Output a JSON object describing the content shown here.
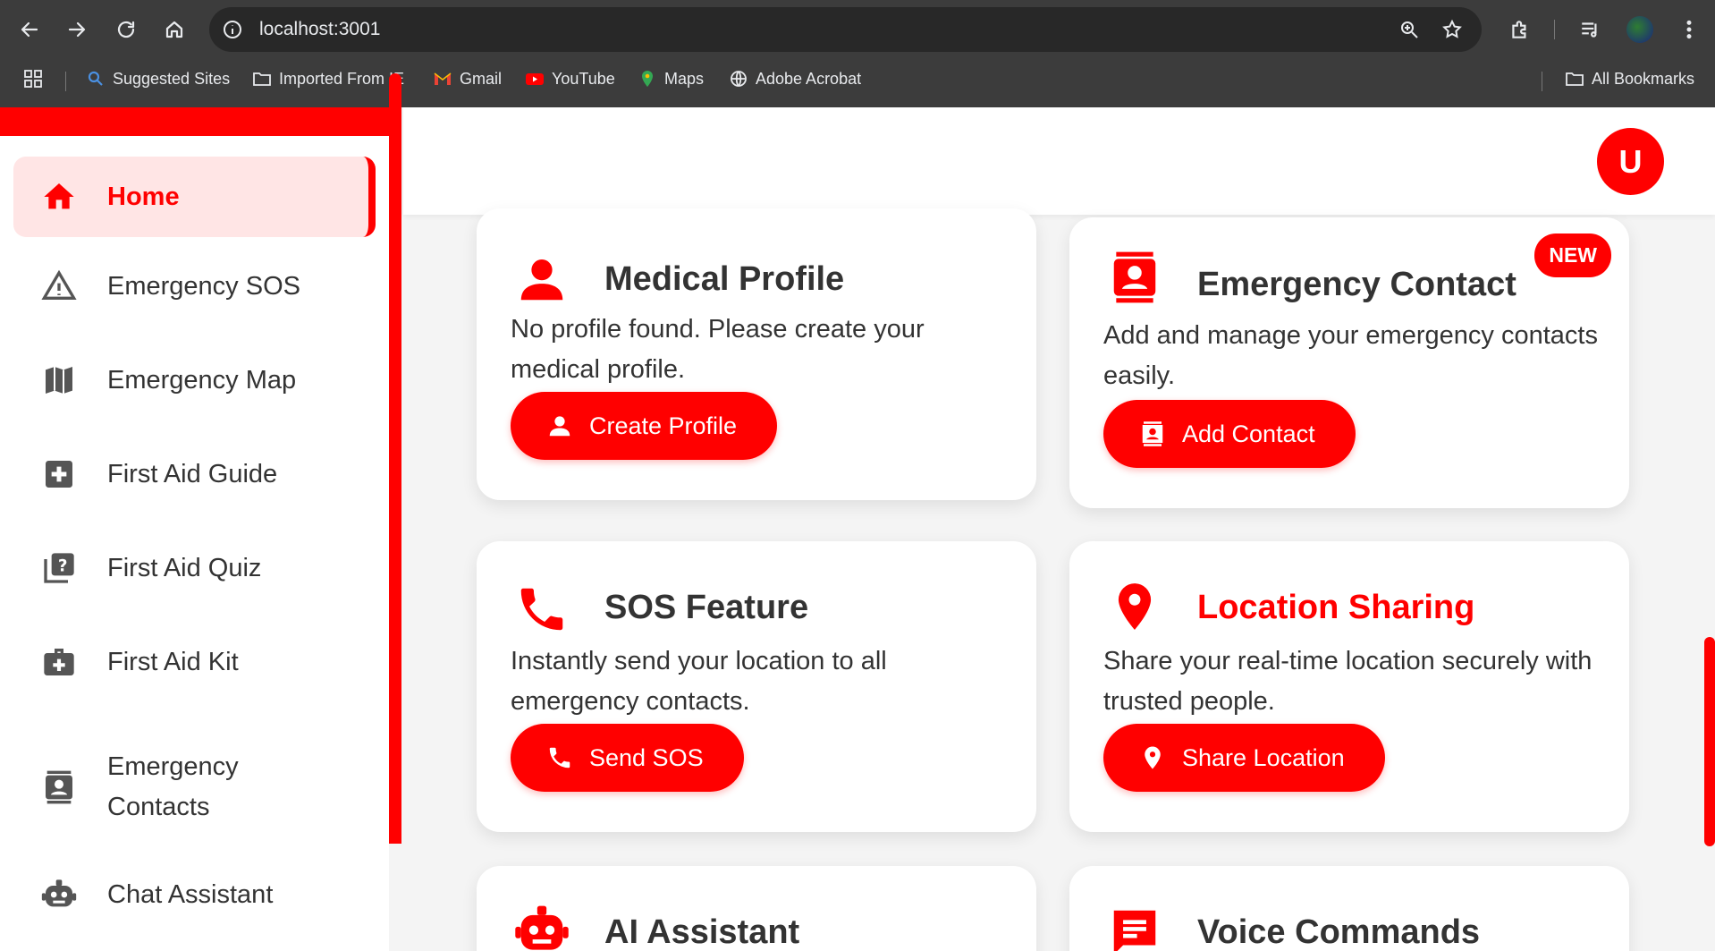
{
  "browser": {
    "url": "localhost:3001",
    "bookmarks": [
      {
        "label": "Suggested Sites",
        "icon": "search-icon"
      },
      {
        "label": "Imported From IE",
        "icon": "folder-icon"
      },
      {
        "label": "Gmail",
        "icon": "gmail-icon"
      },
      {
        "label": "YouTube",
        "icon": "youtube-icon"
      },
      {
        "label": "Maps",
        "icon": "maps-icon"
      },
      {
        "label": "Adobe Acrobat",
        "icon": "globe-icon"
      }
    ],
    "all_bookmarks": "All Bookmarks"
  },
  "sidebar": {
    "items": [
      {
        "label": "Home",
        "icon": "home-icon",
        "active": true
      },
      {
        "label": "Emergency SOS",
        "icon": "warning-icon"
      },
      {
        "label": "Emergency Map",
        "icon": "map-icon"
      },
      {
        "label": "First Aid Guide",
        "icon": "medical-plus-icon"
      },
      {
        "label": "First Aid Quiz",
        "icon": "quiz-icon"
      },
      {
        "label": "First Aid Kit",
        "icon": "medkit-icon"
      },
      {
        "label": "Emergency\nContacts",
        "line1": "Emergency",
        "line2": "Contacts",
        "icon": "contacts-icon"
      },
      {
        "label": "Chat Assistant",
        "icon": "robot-icon"
      }
    ]
  },
  "header": {
    "avatar_letter": "U"
  },
  "cards": {
    "medical": {
      "title": "Medical Profile",
      "desc": "No profile found. Please create your medical profile.",
      "button": "Create Profile"
    },
    "contact": {
      "title": "Emergency Contact",
      "badge": "NEW",
      "desc": "Add and manage your emergency contacts easily.",
      "button": "Add Contact"
    },
    "sos": {
      "title": "SOS Feature",
      "desc": "Instantly send your location to all emergency contacts.",
      "button": "Send SOS"
    },
    "location": {
      "title": "Location Sharing",
      "desc": "Share your real-time location securely with trusted people.",
      "button": "Share Location"
    },
    "ai": {
      "title": "AI Assistant"
    },
    "voice": {
      "title": "Voice Commands"
    }
  },
  "colors": {
    "accent": "#ff0000",
    "active_bg": "#ffe5e5",
    "text": "#333333",
    "chrome": "#3c3c3c"
  }
}
